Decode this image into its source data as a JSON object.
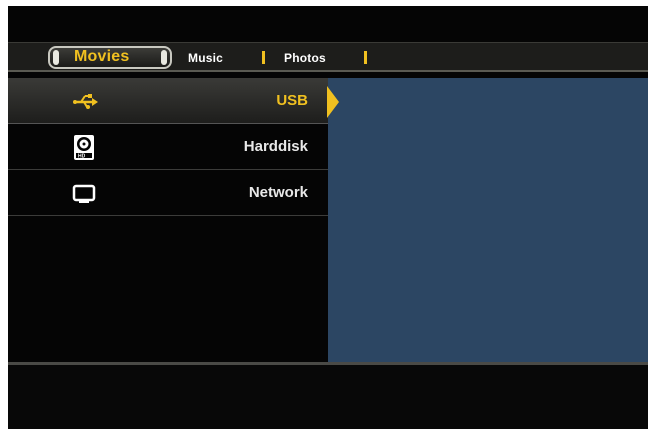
{
  "tabs": [
    {
      "label": "Movies",
      "active": true
    },
    {
      "label": "Music",
      "active": false
    },
    {
      "label": "Photos",
      "active": false
    }
  ],
  "sources": [
    {
      "label": "USB",
      "icon": "usb-icon",
      "selected": true
    },
    {
      "label": "Harddisk",
      "icon": "hdd-icon",
      "selected": false
    },
    {
      "label": "Network",
      "icon": "network-icon",
      "selected": false
    }
  ],
  "colors": {
    "accent": "#f0c020",
    "preview_panel": "#2c4663",
    "background": "#050505"
  }
}
